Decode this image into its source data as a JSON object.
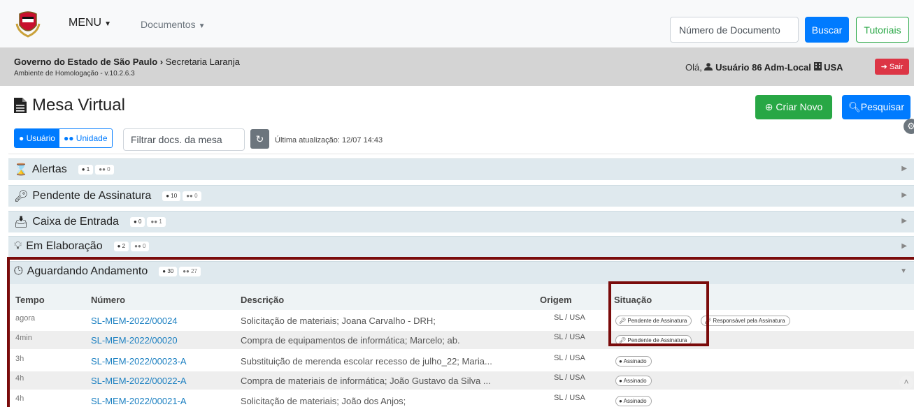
{
  "nav": {
    "menu_label": "MENU",
    "documents_label": "Documentos",
    "search_placeholder": "Número de Documento",
    "search_button": "Buscar",
    "tutorials_button": "Tutoriais"
  },
  "band": {
    "org": "Governo do Estado de São Paulo",
    "separator": "›",
    "dept": "Secretaria Laranja",
    "env": "Ambiente de Homologação - v.10.2.6.3",
    "greeting": "Olá,",
    "user": "Usuário 86 Adm-Local",
    "unit": "USA",
    "logout": "Sair"
  },
  "page": {
    "title": "Mesa Virtual",
    "create_button": "Criar Novo",
    "search_button": "Pesquisar"
  },
  "filter": {
    "user_toggle": "Usuário",
    "unit_toggle": "Unidade",
    "placeholder": "Filtrar docs. da mesa",
    "updated": "Última atualização: 12/07 14:43"
  },
  "sections": [
    {
      "label": "Alertas",
      "user_count": "1",
      "unit_count": "0"
    },
    {
      "label": "Pendente de Assinatura",
      "user_count": "10",
      "unit_count": "0"
    },
    {
      "label": "Caixa de Entrada",
      "user_count": "0",
      "unit_count": "1"
    },
    {
      "label": "Em Elaboração",
      "user_count": "2",
      "unit_count": "0"
    },
    {
      "label": "Aguardando Andamento",
      "user_count": "30",
      "unit_count": "27"
    }
  ],
  "table": {
    "headers": {
      "time": "Tempo",
      "number": "Número",
      "description": "Descrição",
      "origin": "Origem",
      "status": "Situação"
    },
    "rows": [
      {
        "time": "agora",
        "number": "SL-MEM-2022/00024",
        "description": "Solicitação de materiais; Joana Carvalho - DRH;",
        "origin": "SL / USA",
        "status1": "Pendente de Assinatura",
        "status2": "Responsável pela Assinatura"
      },
      {
        "time": "4min",
        "number": "SL-MEM-2022/00020",
        "description": "Compra de equipamentos de informática; Marcelo; ab.",
        "origin": "SL / USA",
        "status1": "Pendente de Assinatura"
      },
      {
        "time": "3h",
        "number": "SL-MEM-2022/00023-A",
        "description": "Substituição de merenda escolar recesso de julho_22; Maria...",
        "origin": "SL / USA",
        "status1": "Assinado"
      },
      {
        "time": "4h",
        "number": "SL-MEM-2022/00022-A",
        "description": "Compra de materiais de informática; João Gustavo da Silva ...",
        "origin": "SL / USA",
        "status1": "Assinado"
      },
      {
        "time": "4h",
        "number": "SL-MEM-2022/00021-A",
        "description": "Solicitação de materiais; João dos Anjos;",
        "origin": "SL / USA",
        "status1": "Assinado"
      }
    ]
  },
  "colors": {
    "primary": "#007bff",
    "success": "#28a745",
    "danger": "#dc3545",
    "highlight": "#7a0b0b"
  }
}
